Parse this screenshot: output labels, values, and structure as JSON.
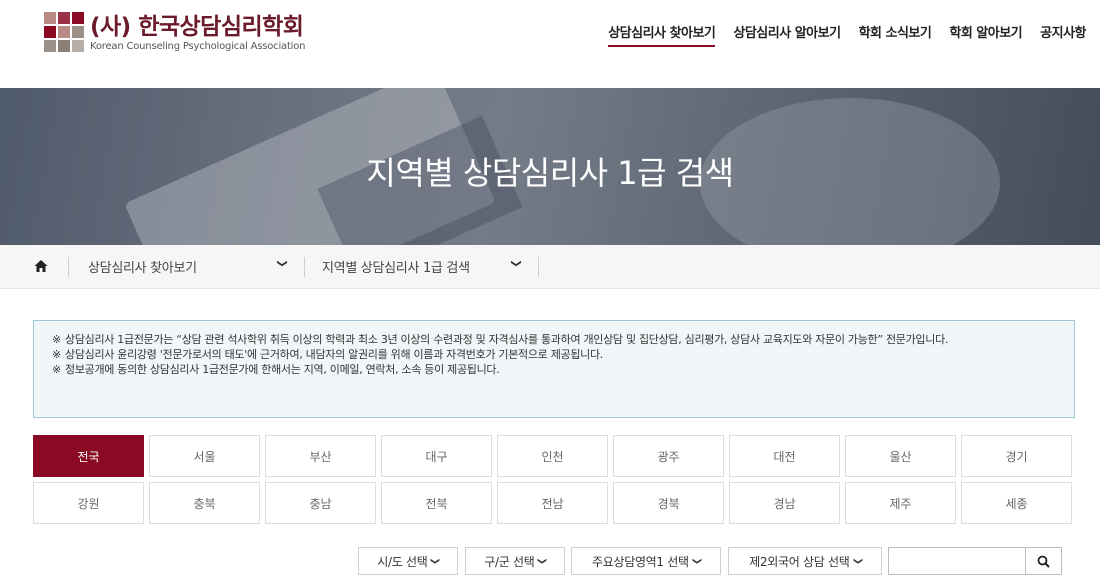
{
  "logo": {
    "title": "(사) 한국상담심리학회",
    "subtitle": "Korean Counseling Psychological Association"
  },
  "nav": [
    {
      "label": "상담심리사 찾아보기",
      "active": true
    },
    {
      "label": "상담심리사 알아보기"
    },
    {
      "label": "학회 소식보기"
    },
    {
      "label": "학회 알아보기"
    },
    {
      "label": "공지사항"
    }
  ],
  "hero": {
    "title": "지역별 상담심리사 1급 검색"
  },
  "breadcrumb": {
    "home_icon": "home-icon",
    "level1": "상담심리사 찾아보기",
    "level2": "지역별 상담심리사 1급 검색"
  },
  "notice": [
    "상담심리사 1급전문가는 “상담 관련 석사학위 취득 이상의 학력과 최소 3년 이상의 수련과정 및 자격심사를 통과하여 개인상담 및 집단상담, 심리평가, 상담사 교육지도와 자문이 가능한” 전문가입니다.",
    "상담심리사 윤리강령 '전문가로서의 태도'에 근거하여, 내담자의 알권리를 위해 이름과 자격번호가 기본적으로 제공됩니다.",
    "정보공개에 동의한 상담심리사 1급전문가에 한해서는 지역, 이메일, 연락처, 소속 등이 제공됩니다."
  ],
  "regions": {
    "row1": [
      "전국",
      "서울",
      "부산",
      "대구",
      "인천",
      "광주",
      "대전",
      "울산",
      "경기"
    ],
    "row2": [
      "강원",
      "충북",
      "충남",
      "전북",
      "전남",
      "경북",
      "경남",
      "제주",
      "세종"
    ],
    "active": "전국"
  },
  "filters": {
    "sido": "시/도 선택",
    "gugun": "구/군 선택",
    "area": "주요상담영역1 선택",
    "language": "제2외국어 상담 선택",
    "search_value": "",
    "search_icon": "search-icon"
  },
  "colors": {
    "brand": "#8a0a23",
    "notice_border": "#9ec8d8"
  }
}
